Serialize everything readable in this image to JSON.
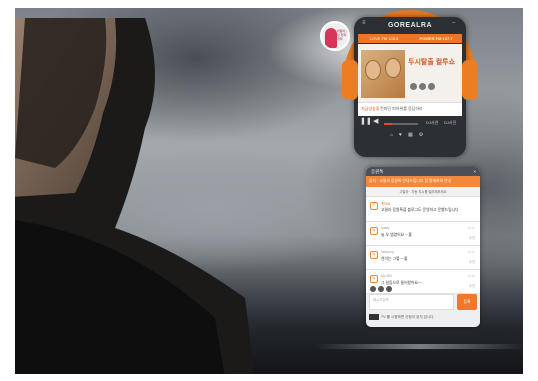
{
  "player": {
    "title": "GOREALRA",
    "tabs": [
      "LOVE FM 103.5",
      "POWER FM 107.7"
    ],
    "active_tab": 1,
    "show_title": "두시탈출 컬투쇼",
    "onair_label": "지금방송중",
    "now_playing": "컨피던 피아위를 응답하라",
    "link_1": "DJ사연",
    "link_2": "DJ사진"
  },
  "chat": {
    "header": "응원톡",
    "close_icon": "×",
    "notice": "공지 · 고릴라 응원톡 안내드립니다 참 원재하의 안내",
    "sub": "고릴라 · 자동 지시를 벌려해보세요",
    "messages": [
      {
        "name": "좋아요",
        "text": "고릴라 응원톡을 블로그도 운영하고 문했드립니다"
      },
      {
        "name": "suaily",
        "text": "늘 오 앱였어요 ~ 좋",
        "time": "12:11",
        "rate": "추천"
      },
      {
        "name": "heeyung",
        "text": "연이는 그렇~~좋",
        "time": "12:11",
        "rate": "추천"
      },
      {
        "name": "Mo 500",
        "text": "그 일등으로 들어왔어요~~",
        "time": "12:10",
        "rate": "추천"
      }
    ],
    "input_placeholder": "메시지입력",
    "send_label": "등록",
    "footer": "TV 를 시청하면 신청이 공지 압니다"
  },
  "profile": {
    "caption": "바람이 불던 전화 개미"
  },
  "colors": {
    "accent": "#ec7d22",
    "player_body": "#2c2f33",
    "chat_header": "#4b5058"
  }
}
